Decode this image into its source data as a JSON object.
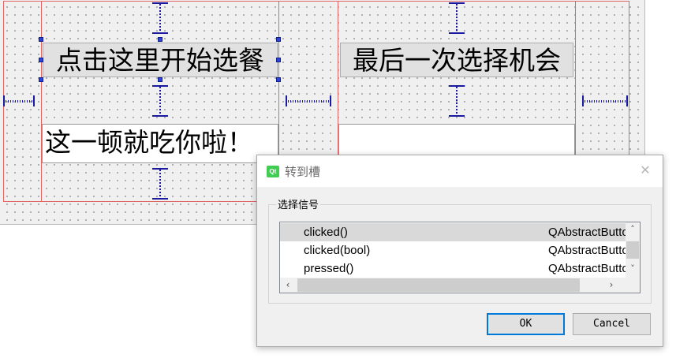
{
  "form": {
    "left_button_text": "点击这里开始选餐",
    "right_button_text": "最后一次选择机会",
    "left_label_text": "这一顿就吃你啦！",
    "right_label_text": ""
  },
  "dialog": {
    "title": "转到槽",
    "app_icon_text": "Qt",
    "close_glyph": "✕",
    "group_title": "选择信号",
    "signals": [
      {
        "name": "clicked()",
        "class": "QAbstractButton",
        "selected": true
      },
      {
        "name": "clicked(bool)",
        "class": "QAbstractButton",
        "selected": false
      },
      {
        "name": "pressed()",
        "class": "QAbstractButton",
        "selected": false
      }
    ],
    "scroll_up": "˄",
    "scroll_down": "˅",
    "scroll_left": "‹",
    "scroll_right": "›",
    "ok_label": "OK",
    "cancel_label": "Cancel"
  },
  "colors": {
    "layout_border": "#e06666",
    "spacer": "#1a1aa0",
    "selection_handle": "#2f43d6",
    "default_button_border": "#0078d7",
    "qt_green": "#41cd52"
  },
  "icons": {
    "app": "qt-logo-icon",
    "close": "close-icon",
    "scroll_up": "chevron-up-icon",
    "scroll_down": "chevron-down-icon",
    "scroll_left": "chevron-left-icon",
    "scroll_right": "chevron-right-icon"
  }
}
